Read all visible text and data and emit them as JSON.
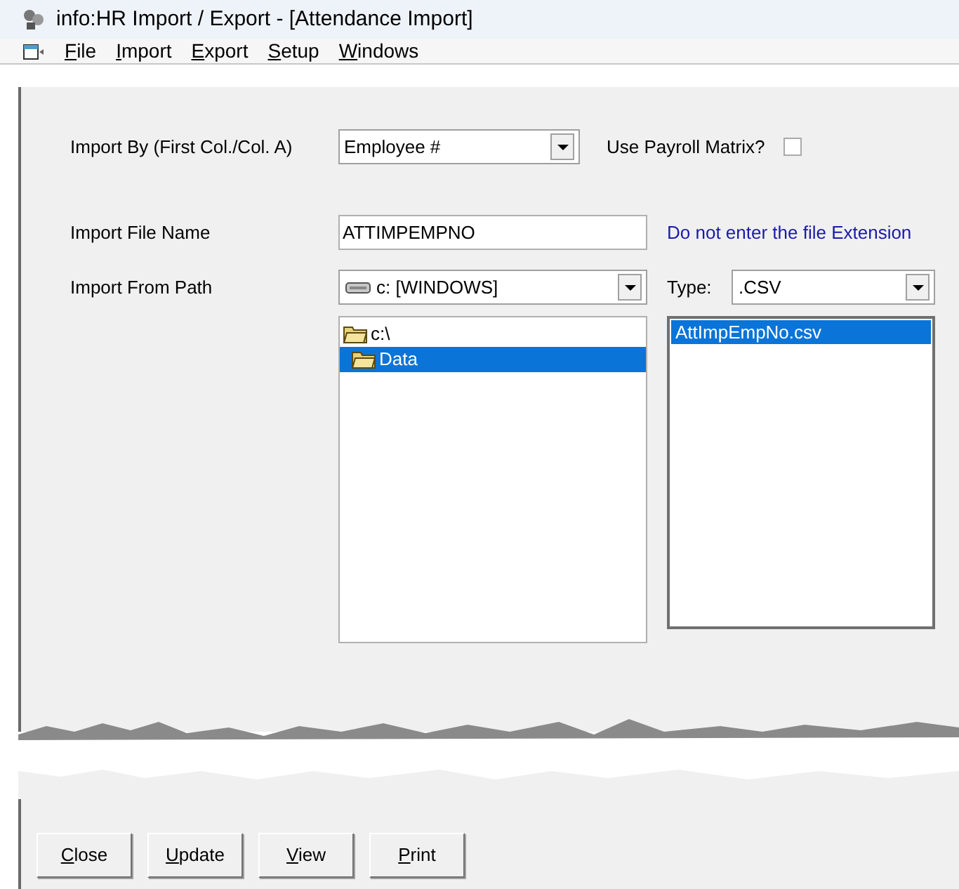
{
  "window": {
    "title": "info:HR Import / Export - [Attendance Import]"
  },
  "menu": [
    {
      "label": "File"
    },
    {
      "label": "Import"
    },
    {
      "label": "Export"
    },
    {
      "label": "Setup"
    },
    {
      "label": "Windows"
    }
  ],
  "import_by": {
    "label": "Import By (First Col./Col. A)",
    "value": "Employee #"
  },
  "payroll_matrix": {
    "label": "Use Payroll Matrix?",
    "checked": false
  },
  "file_name": {
    "label": "Import File Name",
    "value": "ATTIMPEMPNO",
    "hint": "Do not enter the file Extension"
  },
  "path": {
    "label": "Import From Path",
    "drive": "c: [WINDOWS]",
    "type_label": "Type:",
    "type_value": ".CSV"
  },
  "folders": [
    {
      "label": "c:\\",
      "selected": false
    },
    {
      "label": "Data",
      "selected": true
    }
  ],
  "files": [
    {
      "label": "AttImpEmpNo.csv",
      "selected": true
    }
  ],
  "buttons": [
    {
      "label": "Close"
    },
    {
      "label": "Update"
    },
    {
      "label": "View"
    },
    {
      "label": "Print"
    }
  ]
}
